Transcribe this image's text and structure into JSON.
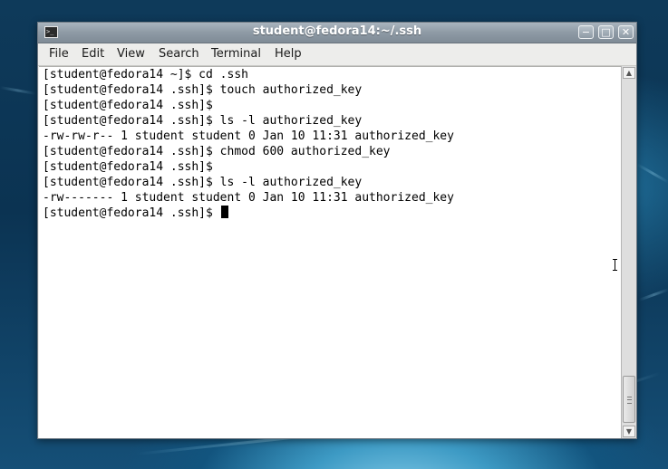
{
  "window": {
    "title": "student@fedora14:~/.ssh",
    "icon": "terminal-icon",
    "controls": {
      "minimize": "minimize-icon",
      "maximize": "maximize-icon",
      "close": "close-icon"
    }
  },
  "menubar": {
    "items": [
      "File",
      "Edit",
      "View",
      "Search",
      "Terminal",
      "Help"
    ]
  },
  "terminal": {
    "lines": [
      "[student@fedora14 ~]$ cd .ssh",
      "[student@fedora14 .ssh]$ touch authorized_key",
      "[student@fedora14 .ssh]$",
      "[student@fedora14 .ssh]$ ls -l authorized_key",
      "-rw-rw-r-- 1 student student 0 Jan 10 11:31 authorized_key",
      "[student@fedora14 .ssh]$ chmod 600 authorized_key",
      "[student@fedora14 .ssh]$",
      "[student@fedora14 .ssh]$ ls -l authorized_key",
      "-rw------- 1 student student 0 Jan 10 11:31 authorized_key"
    ],
    "prompt": "[student@fedora14 .ssh]$ "
  },
  "scrollbar": {
    "position_fraction": 1.0,
    "up_icon": "arrow-up-icon",
    "down_icon": "arrow-down-icon"
  },
  "colors": {
    "titlebar": "#8e9aa5",
    "terminal_bg": "#ffffff",
    "terminal_fg": "#000000",
    "desktop": "#0e3a5a"
  }
}
